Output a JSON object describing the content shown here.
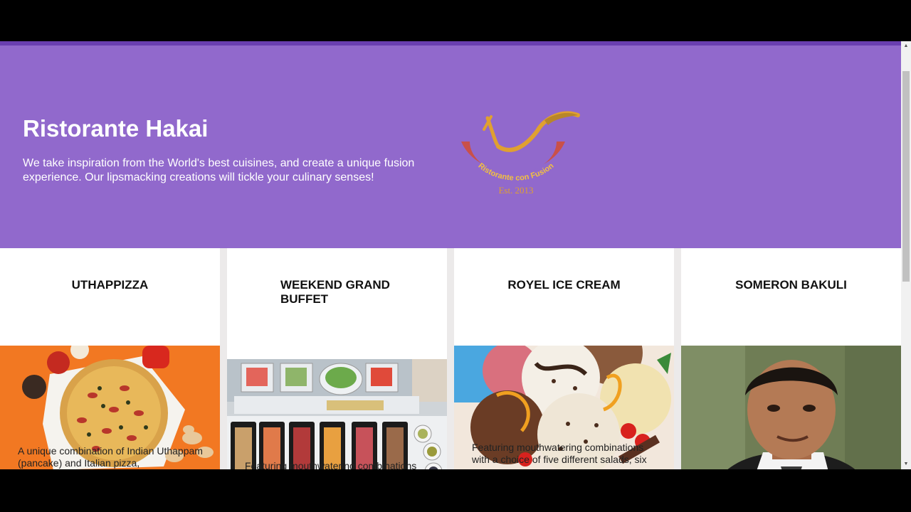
{
  "hero": {
    "title": "Ristorante Hakai",
    "description": "We take inspiration from the World's best cuisines, and create a unique fusion experience. Our lipsmacking creations will tickle your culinary senses!",
    "logo_text": "Ristorante con Fusion",
    "logo_est": "Est. 2013"
  },
  "cards": [
    {
      "title": "UTHAPPIZZA",
      "image": "pizza-image",
      "text": "A unique combination of Indian Uthappam (pancake) and Italian pizza,"
    },
    {
      "title": "WEEKEND GRAND BUFFET",
      "image": "buffet-image",
      "text": "Featuring mouthwatering combinations"
    },
    {
      "title": "ROYEL ICE CREAM",
      "image": "ice-cream-image",
      "text": "Featuring mouthwatering combinations with a choice of five different salads, six"
    },
    {
      "title": "SOMERON BAKULI",
      "image": "person-photo",
      "text": ""
    }
  ],
  "scrollbar": {
    "up_arrow": "▲",
    "down_arrow": "▼"
  },
  "colors": {
    "jumbotron": "#9169cc",
    "accent": "#6a3fb0",
    "logo_red": "#c9504a",
    "logo_gold": "#e0a030"
  }
}
